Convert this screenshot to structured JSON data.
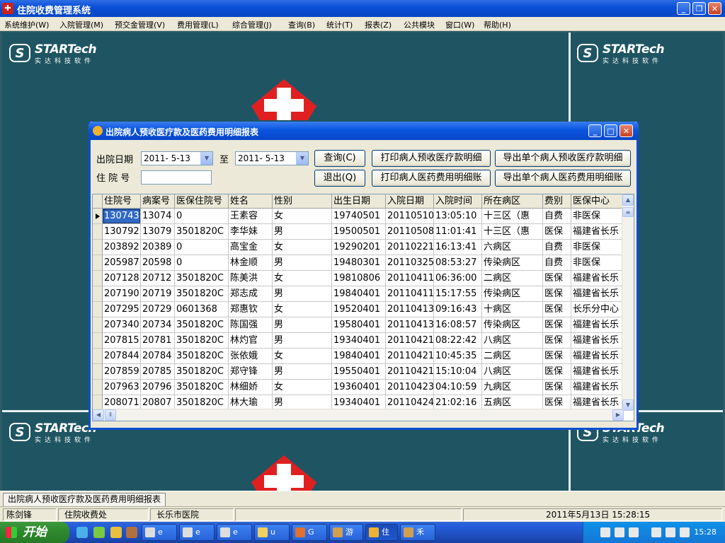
{
  "app": {
    "title": "住院收费管理系统"
  },
  "menu": [
    "系统维护(W)",
    "入院管理(M)",
    "预交金管理(V)",
    "费用管理(L)",
    "综合管理(J)",
    "查询(B)",
    "统计(T)",
    "报表(Z)",
    "公共模块",
    "窗口(W)",
    "帮助(H)"
  ],
  "brand": {
    "name": "STARTech",
    "sub": "实达科技软件"
  },
  "dialog": {
    "title": "出院病人预收医疗款及医药费用明细报表",
    "date_label": "出院日期",
    "date_from": "2011- 5-13",
    "to_label": "至",
    "date_to": "2011- 5-13",
    "inpatient_label": "住 院 号",
    "inpatient_value": "",
    "buttons": {
      "query": "查询(C)",
      "exit": "退出(Q)",
      "print_prepay": "打印病人预收医疗款明细",
      "print_drug": "打印病人医药费用明细账",
      "export_prepay": "导出单个病人预收医疗款明细",
      "export_drug": "导出单个病人医药费用明细账"
    }
  },
  "grid": {
    "columns": [
      "住院号",
      "病案号",
      "医保住院号",
      "姓名",
      "性别",
      "出生日期",
      "入院日期",
      "入院时间",
      "所在病区",
      "费别",
      "医保中心"
    ],
    "rows": [
      [
        "130743(",
        "13074",
        "0",
        "王素容",
        "女",
        "19740501",
        "20110510",
        "13:05:10",
        "十三区（惠",
        "自费",
        "非医保"
      ],
      [
        "130792",
        "13079",
        "3501820C",
        "李华妹",
        "男",
        "19500501",
        "20110508",
        "11:01:41",
        "十三区（惠",
        "医保",
        "福建省长乐"
      ],
      [
        "203892",
        "20389",
        "0",
        "高宝金",
        "女",
        "19290201",
        "20110221",
        "16:13:41",
        "六病区",
        "自费",
        "非医保"
      ],
      [
        "205987",
        "20598",
        "0",
        "林金顺",
        "男",
        "19480301",
        "20110325",
        "08:53:27",
        "传染病区",
        "自费",
        "非医保"
      ],
      [
        "207128",
        "20712",
        "3501820C",
        "陈美洪",
        "女",
        "19810806",
        "20110411",
        "06:36:00",
        "二病区",
        "医保",
        "福建省长乐"
      ],
      [
        "207190",
        "20719",
        "3501820C",
        "郑志成",
        "男",
        "19840401",
        "20110411",
        "15:17:55",
        "传染病区",
        "医保",
        "福建省长乐"
      ],
      [
        "207295",
        "20729",
        "0601368",
        "郑惠钦",
        "女",
        "19520401",
        "20110413",
        "09:16:43",
        "十病区",
        "医保",
        "长乐分中心"
      ],
      [
        "207340",
        "20734",
        "3501820C",
        "陈国强",
        "男",
        "19580401",
        "20110413",
        "16:08:57",
        "传染病区",
        "医保",
        "福建省长乐"
      ],
      [
        "207815",
        "20781",
        "3501820C",
        "林灼官",
        "男",
        "19340401",
        "20110421",
        "08:22:42",
        "八病区",
        "医保",
        "福建省长乐"
      ],
      [
        "207844",
        "20784",
        "3501820C",
        "张依娥",
        "女",
        "19840401",
        "20110421",
        "10:45:35",
        "二病区",
        "医保",
        "福建省长乐"
      ],
      [
        "207859",
        "20785",
        "3501820C",
        "郑守锋",
        "男",
        "19550401",
        "20110421",
        "15:10:04",
        "八病区",
        "医保",
        "福建省长乐"
      ],
      [
        "207963",
        "20796",
        "3501820C",
        "林细娇",
        "女",
        "19360401",
        "20110423",
        "04:10:59",
        "九病区",
        "医保",
        "福建省长乐"
      ],
      [
        "208071",
        "20807",
        "3501820C",
        "林大瑜",
        "男",
        "19340401",
        "20110424",
        "21:02:16",
        "五病区",
        "医保",
        "福建省长乐"
      ]
    ]
  },
  "tabs": [
    "出院病人预收医疗款及医药费用明细报表"
  ],
  "status": {
    "user": "陈剑锋",
    "dept": "住院收费处",
    "hospital": "长乐市医院",
    "datetime": "2011年5月13日 15:28:15"
  },
  "taskbar": {
    "start": "开始",
    "items": [
      "e",
      "e",
      "e",
      "u",
      "G",
      "游",
      "住",
      "禾"
    ],
    "clock": "15:28"
  },
  "colors": {
    "desktop": "#1f5562",
    "titlebar": "#0a4fd6",
    "dialog_bg": "#ece9d8",
    "selected_cell": "#316ac5"
  }
}
